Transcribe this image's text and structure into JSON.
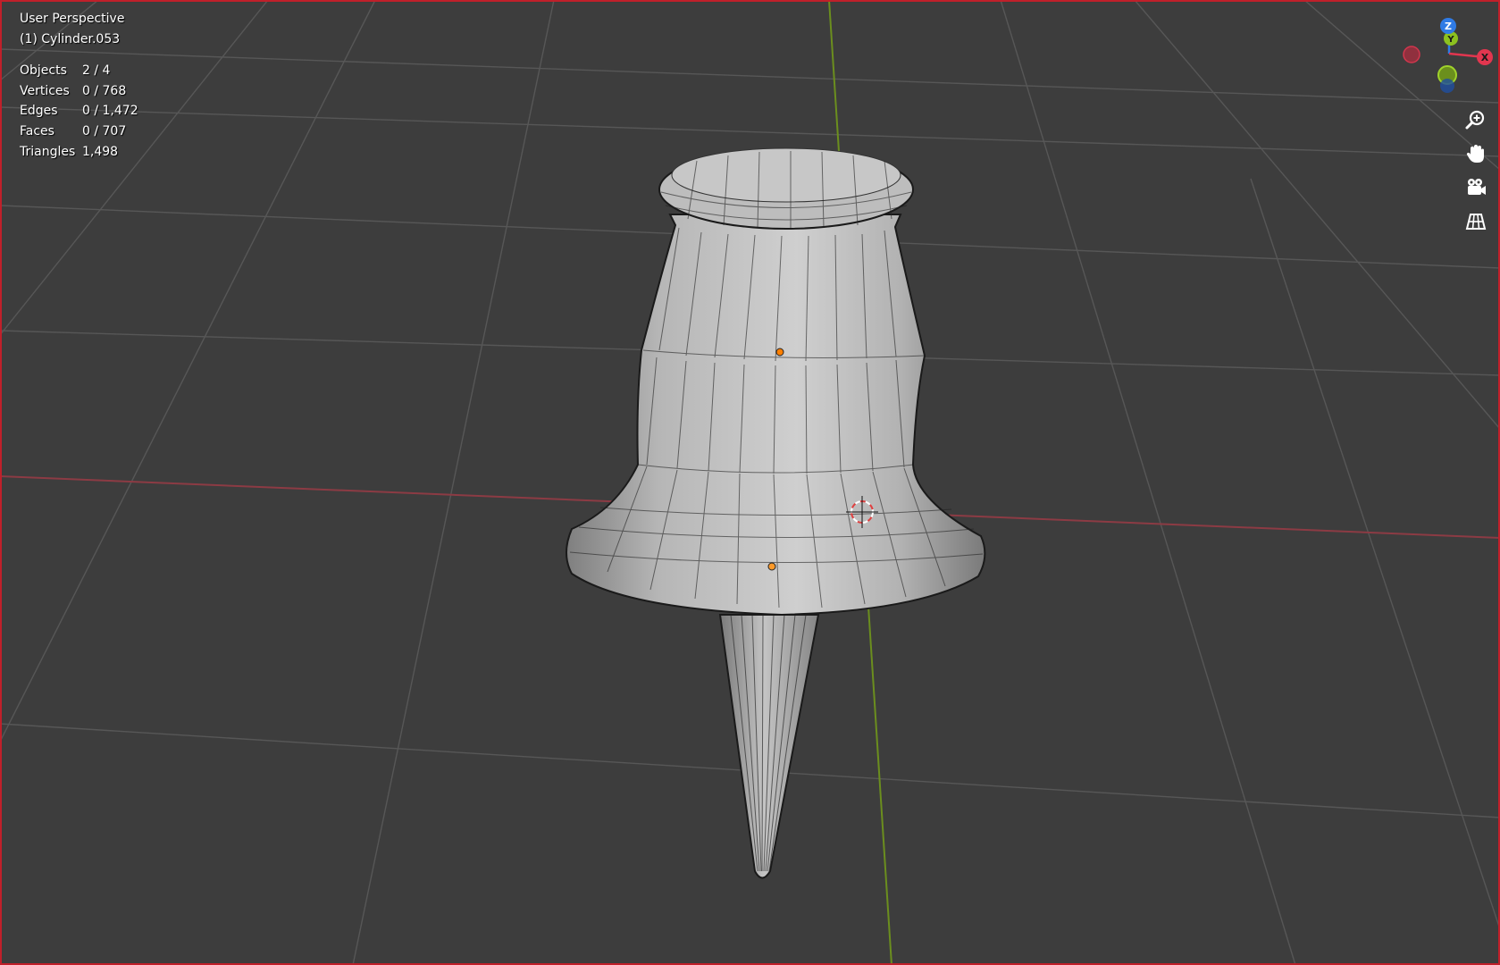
{
  "viewport": {
    "view_name": "User Perspective",
    "active_object": "(1) Cylinder.053"
  },
  "stats": [
    {
      "label": "Objects",
      "value": "2 / 4"
    },
    {
      "label": "Vertices",
      "value": "0 / 768"
    },
    {
      "label": "Edges",
      "value": "0 / 1,472"
    },
    {
      "label": "Faces",
      "value": "0 / 707"
    },
    {
      "label": "Triangles",
      "value": "1,498"
    }
  ],
  "gizmo": {
    "axes": [
      {
        "name": "Z",
        "color": "#2f7be5"
      },
      {
        "name": "Y",
        "color": "#8cc11f"
      },
      {
        "name": "X",
        "color": "#e2364f"
      }
    ]
  },
  "nav_tools": [
    {
      "icon": "zoom-icon"
    },
    {
      "icon": "pan-hand-icon"
    },
    {
      "icon": "camera-icon"
    },
    {
      "icon": "ortho-grid-icon"
    }
  ],
  "colors": {
    "background": "#3d3d3d",
    "grid": "#555555",
    "x_axis": "#8c3b44",
    "y_axis": "#6b8e1e",
    "mesh": "#a9a9a9",
    "wire": "#111111",
    "origin": "#ff7f00",
    "border": "#c0202a"
  }
}
